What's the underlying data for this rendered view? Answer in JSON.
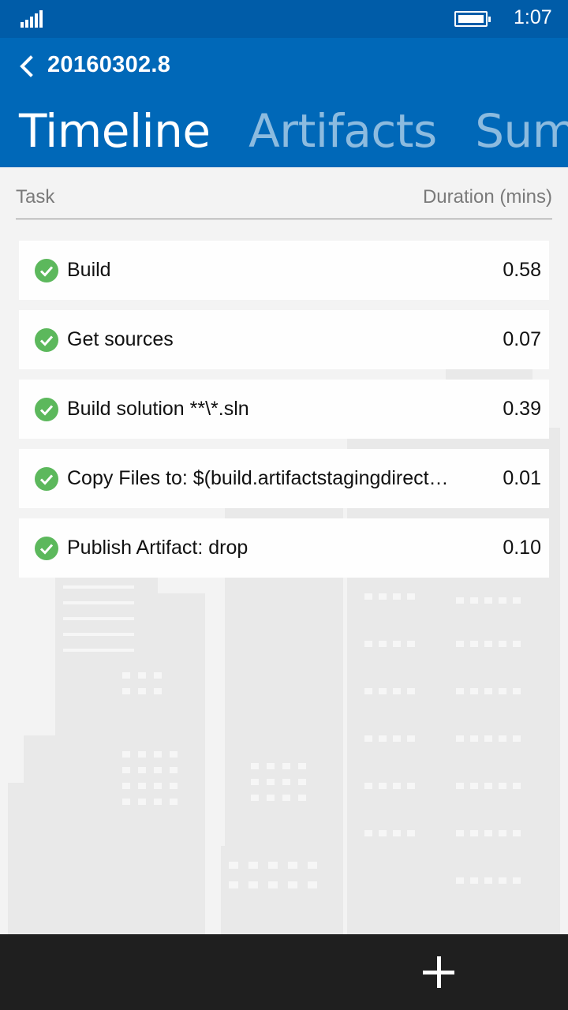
{
  "status_bar": {
    "time": "1:07",
    "signal_icon": "signal-strength-icon",
    "battery_icon": "battery-full-icon",
    "battery_level": 1.0
  },
  "header": {
    "back_icon": "chevron-left-icon",
    "title": "20160302.8",
    "pivots": [
      {
        "label": "Timeline",
        "active": true
      },
      {
        "label": "Artifacts",
        "active": false
      },
      {
        "label": "Summa",
        "active": false
      }
    ],
    "background": "#0068b8"
  },
  "table": {
    "col_task": "Task",
    "col_duration": "Duration (mins)",
    "rows": [
      {
        "name": "Build",
        "duration": "0.58",
        "status": "succeeded"
      },
      {
        "name": "Get sources",
        "duration": "0.07",
        "status": "succeeded"
      },
      {
        "name": "Build solution **\\*.sln",
        "duration": "0.39",
        "status": "succeeded"
      },
      {
        "name": "Copy Files to: $(build.artifactstagingdirect…",
        "duration": "0.01",
        "status": "succeeded"
      },
      {
        "name": "Publish Artifact: drop",
        "duration": "0.10",
        "status": "succeeded"
      }
    ],
    "success_color": "#5cb85c"
  },
  "app_bar": {
    "add_icon": "plus-icon"
  }
}
